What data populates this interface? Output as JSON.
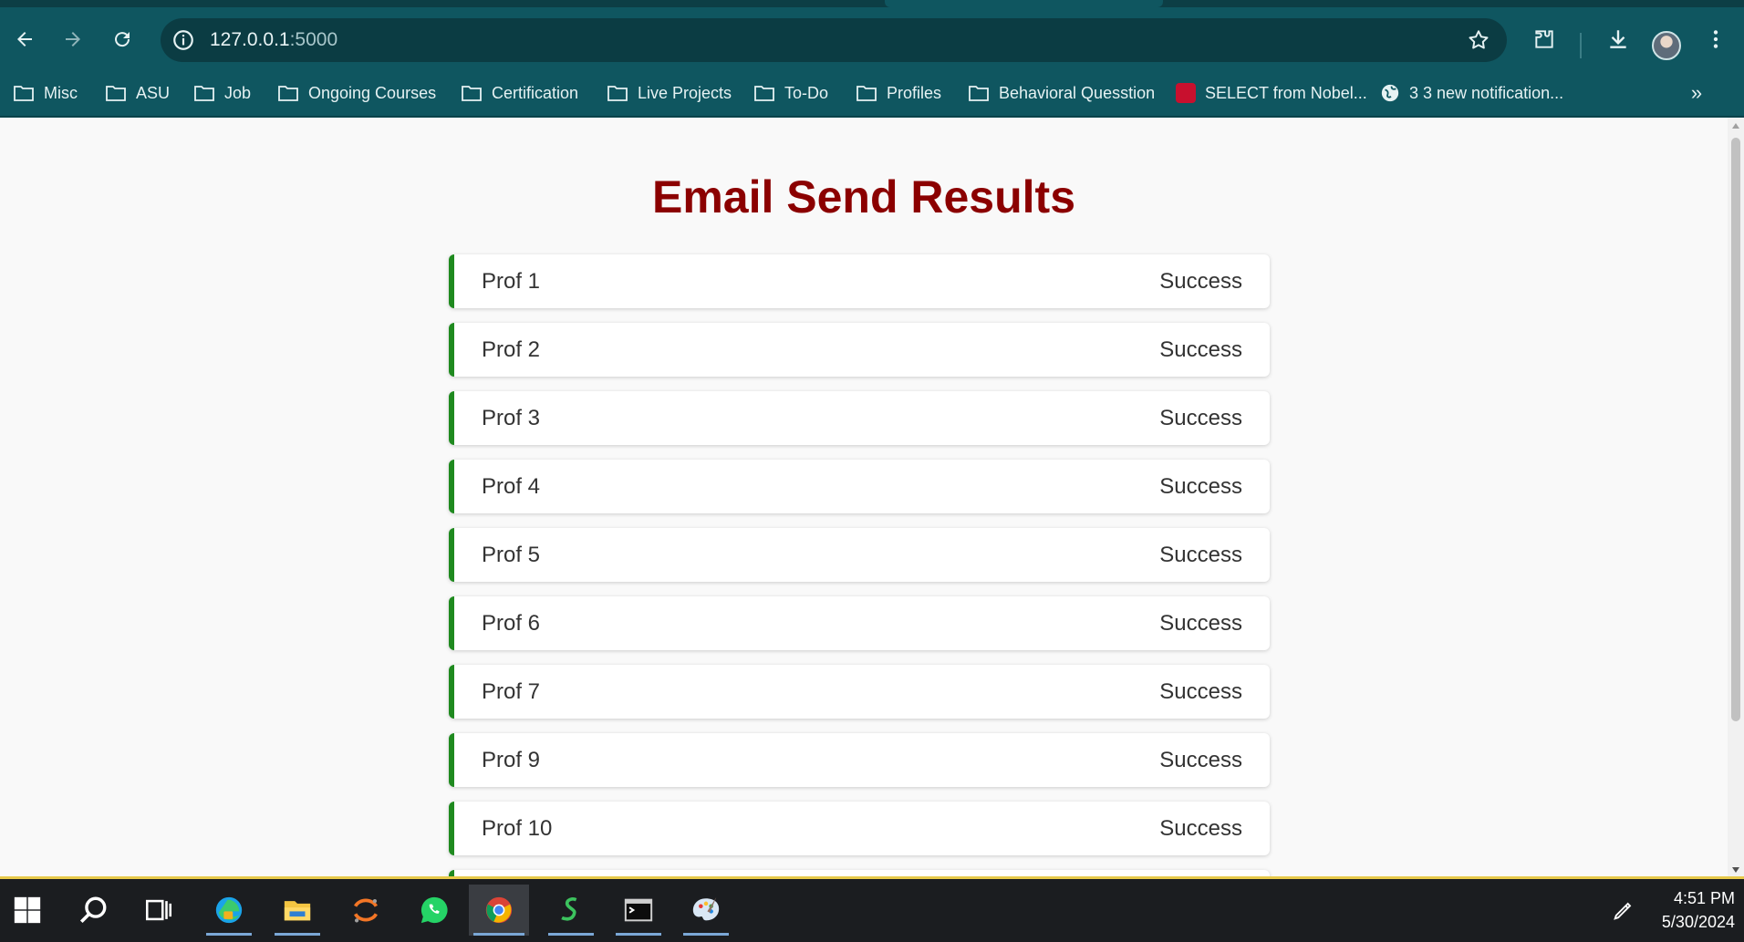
{
  "browser": {
    "url_host": "127.0.0.1",
    "url_port": ":5000",
    "bookmarks": [
      {
        "label": "Misc",
        "icon": "folder-icon"
      },
      {
        "label": "ASU",
        "icon": "folder-icon"
      },
      {
        "label": "Job",
        "icon": "folder-icon"
      },
      {
        "label": "Ongoing Courses",
        "icon": "folder-icon"
      },
      {
        "label": "Certification",
        "icon": "folder-icon"
      },
      {
        "label": "Live Projects",
        "icon": "folder-icon"
      },
      {
        "label": "To-Do",
        "icon": "folder-icon"
      },
      {
        "label": "Profiles",
        "icon": "folder-icon"
      },
      {
        "label": "Behavioral Quesstion",
        "icon": "folder-icon"
      },
      {
        "label": "SELECT from Nobel...",
        "icon": "sql-site-icon"
      },
      {
        "label": "3 3 new notification...",
        "icon": "globe-icon"
      }
    ],
    "more_bookmarks": "»"
  },
  "page": {
    "title": "Email Send Results",
    "results": [
      {
        "name": "Prof 1",
        "status": "Success"
      },
      {
        "name": "Prof 2",
        "status": "Success"
      },
      {
        "name": "Prof 3",
        "status": "Success"
      },
      {
        "name": "Prof 4",
        "status": "Success"
      },
      {
        "name": "Prof 5",
        "status": "Success"
      },
      {
        "name": "Prof 6",
        "status": "Success"
      },
      {
        "name": "Prof 7",
        "status": "Success"
      },
      {
        "name": "Prof 9",
        "status": "Success"
      },
      {
        "name": "Prof 10",
        "status": "Success"
      }
    ],
    "colors": {
      "title": "#8b0000",
      "success_border": "#1f8a1f"
    }
  },
  "taskbar": {
    "time": "4:51 PM",
    "date": "5/30/2024",
    "apps": [
      "windows-start-icon",
      "search-icon",
      "task-view-icon",
      "edge-icon",
      "file-explorer-icon",
      "jupyter-icon",
      "whatsapp-icon",
      "chrome-icon",
      "snip-icon",
      "terminal-icon",
      "paint-icon"
    ]
  }
}
